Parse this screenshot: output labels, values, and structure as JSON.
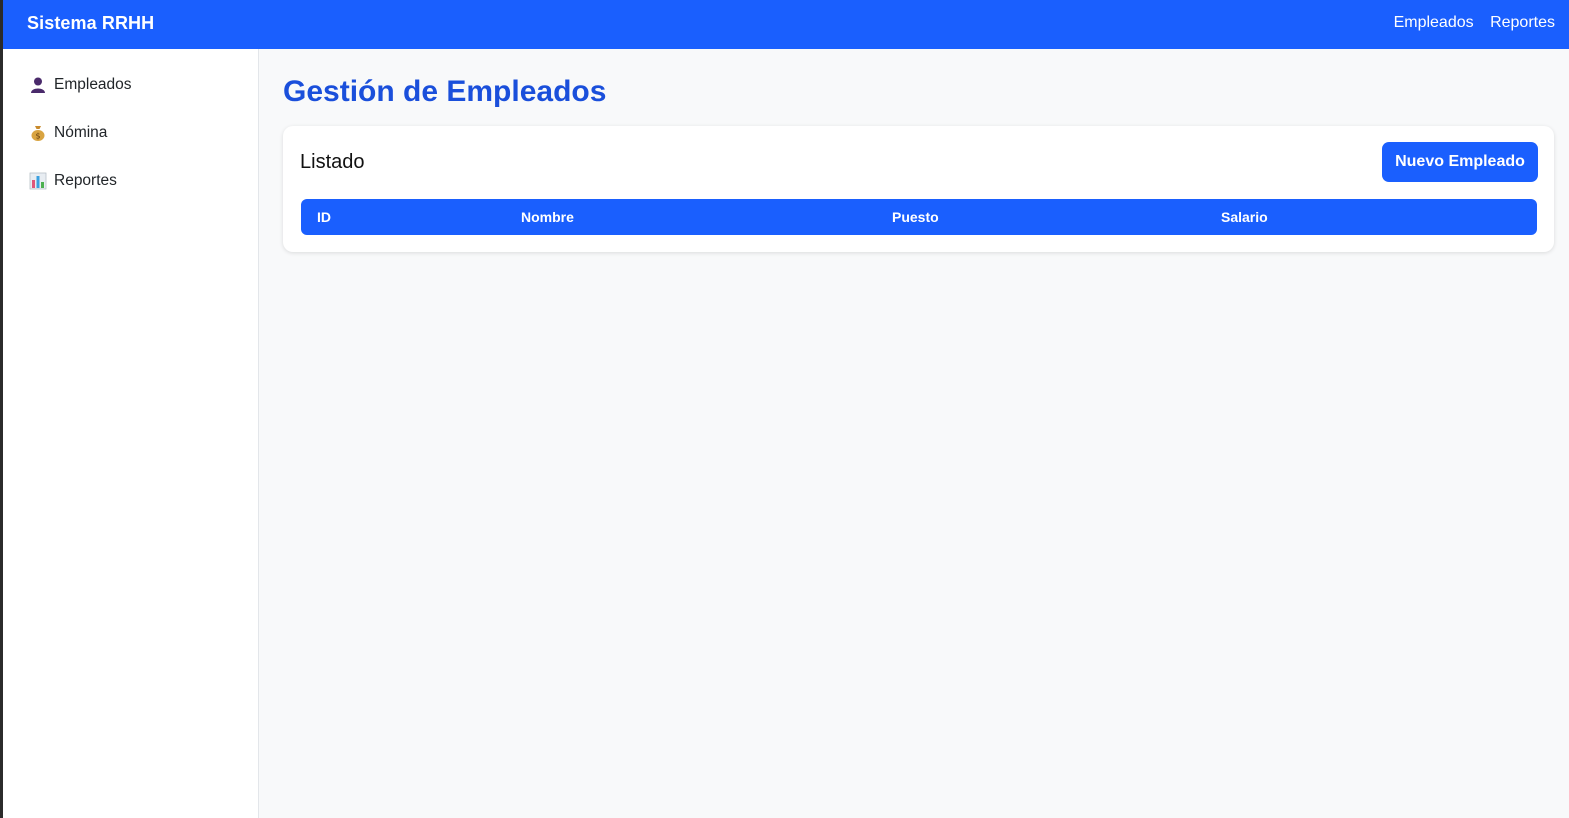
{
  "navbar": {
    "brand": "Sistema RRHH",
    "links": [
      "Empleados",
      "Reportes"
    ]
  },
  "sidebar": {
    "items": [
      {
        "label": "Empleados",
        "icon": "person-icon"
      },
      {
        "label": "Nómina",
        "icon": "money-bag-icon"
      },
      {
        "label": "Reportes",
        "icon": "bar-chart-icon"
      }
    ]
  },
  "main": {
    "title": "Gestión de Empleados",
    "card": {
      "title": "Listado",
      "new_button": "Nuevo Empleado",
      "columns": [
        "ID",
        "Nombre",
        "Puesto",
        "Salario"
      ]
    }
  },
  "colors": {
    "primary": "#1a5ffe",
    "title": "#1a4fdb",
    "background": "#f8f9fa"
  }
}
